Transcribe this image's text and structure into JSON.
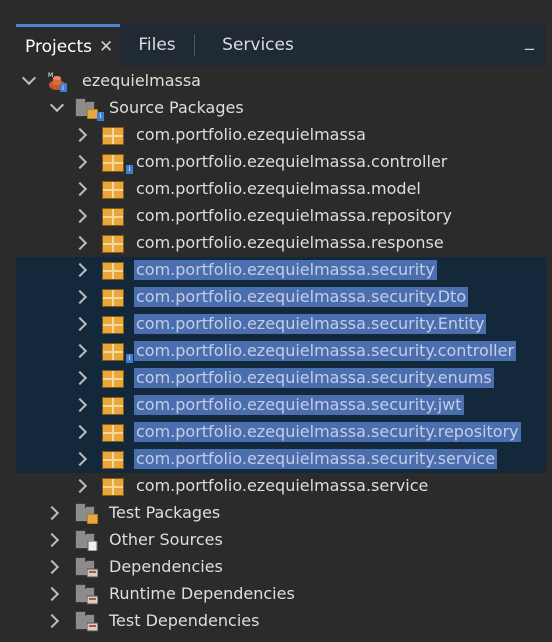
{
  "tabs": {
    "projects": "Projects",
    "close": "✕",
    "files": "Files",
    "services": "Services",
    "minimize": "_"
  },
  "tree": {
    "project": "ezequielmassa",
    "source_packages": "Source Packages",
    "packages": [
      "com.portfolio.ezequielmassa",
      "com.portfolio.ezequielmassa.controller",
      "com.portfolio.ezequielmassa.model",
      "com.portfolio.ezequielmassa.repository",
      "com.portfolio.ezequielmassa.response",
      "com.portfolio.ezequielmassa.security",
      "com.portfolio.ezequielmassa.security.Dto",
      "com.portfolio.ezequielmassa.security.Entity",
      "com.portfolio.ezequielmassa.security.controller",
      "com.portfolio.ezequielmassa.security.enums",
      "com.portfolio.ezequielmassa.security.jwt",
      "com.portfolio.ezequielmassa.security.repository",
      "com.portfolio.ezequielmassa.security.service",
      "com.portfolio.ezequielmassa.service"
    ],
    "test_packages": "Test Packages",
    "other_sources": "Other Sources",
    "dependencies": "Dependencies",
    "runtime_dependencies": "Runtime Dependencies",
    "test_dependencies": "Test Dependencies"
  },
  "colors": {
    "background": "#2b2b2b",
    "tab_bar": "#1f2a35",
    "tab_accent": "#4a86d4",
    "selection_row": "#13283a",
    "selection_label": "#4b6eaf",
    "package_icon": "#e8a73c"
  },
  "icons": {
    "project": "maven-project-icon",
    "package": "java-package-icon",
    "folder": "folder-icon",
    "expanded": "chevron-down-icon",
    "collapsed": "chevron-right-icon"
  }
}
